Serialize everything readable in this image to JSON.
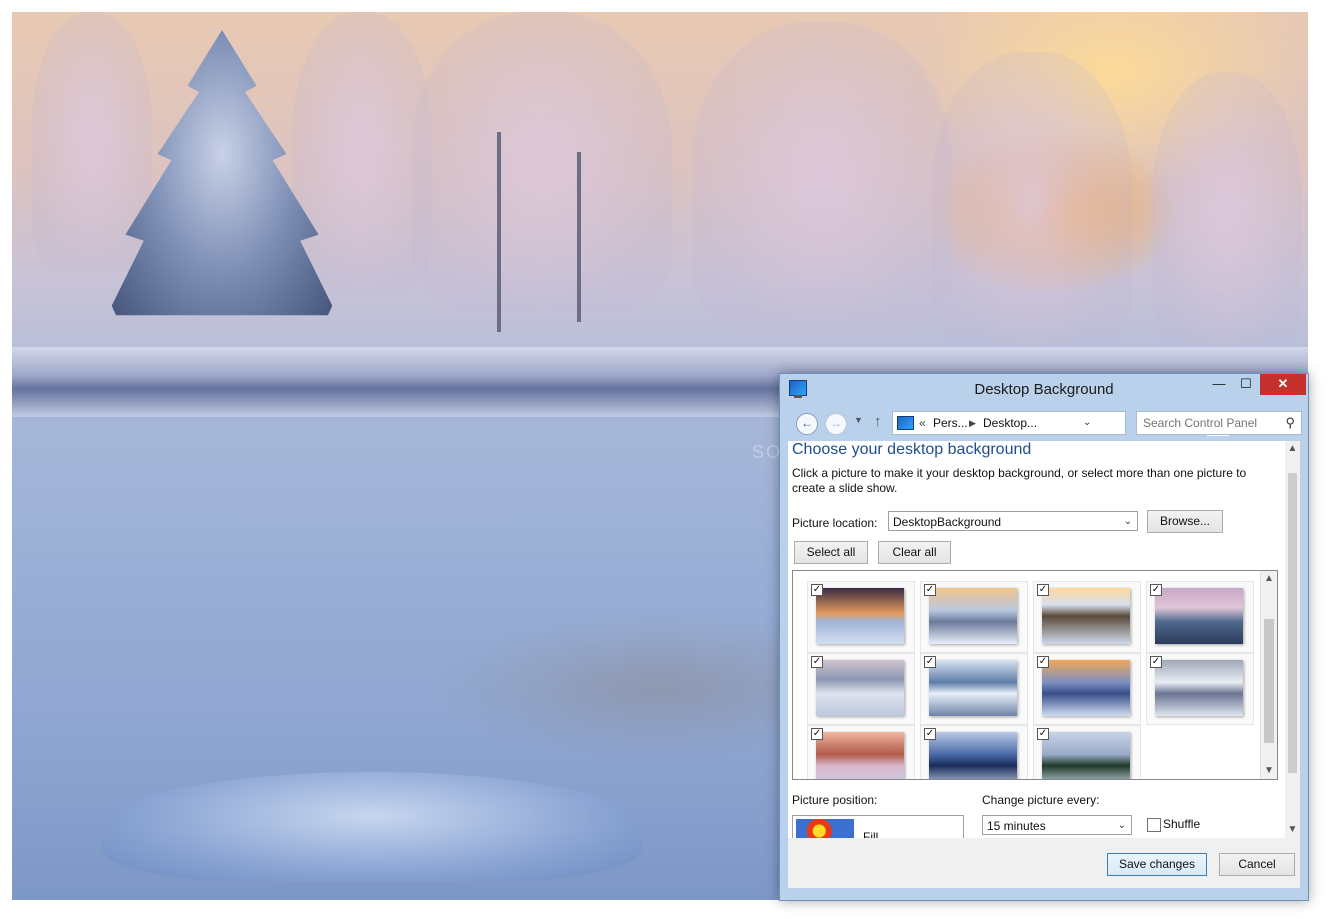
{
  "window": {
    "title": "Desktop Background"
  },
  "address": {
    "overflow": "«",
    "crumb1": "Pers...",
    "crumb2": "Desktop...",
    "search_placeholder": "Search Control Panel"
  },
  "content": {
    "heading": "Choose your desktop background",
    "description": "Click a picture to make it your desktop background, or select more than one picture to create a slide show.",
    "picture_location_label": "Picture location:",
    "picture_location_value": "DesktopBackground",
    "browse_label": "Browse...",
    "select_all_label": "Select all",
    "clear_all_label": "Clear all",
    "picture_position_label": "Picture position:",
    "picture_position_value": "Fill",
    "change_every_label": "Change picture every:",
    "change_every_value": "15 minutes",
    "shuffle_label": "Shuffle"
  },
  "thumbnails": [
    {
      "checked": true,
      "bg": "linear-gradient(#3a2a44,#e49a5a 45%,#9fb4d8 60%,#d5def0)"
    },
    {
      "checked": true,
      "bg": "linear-gradient(#f2c68a,#b9c7e0 40%,#6a7a9a 60%,#e8eef8)"
    },
    {
      "checked": true,
      "bg": "linear-gradient(#ffd79a,#d7e0ef 30%,#5a4a3a 50%,#cfd9ea)"
    },
    {
      "checked": true,
      "bg": "linear-gradient(#c9a7c9,#e0c6d6 35%,#506a8f 60%,#2a3a5a)"
    },
    {
      "checked": true,
      "bg": "linear-gradient(#cfc3cd,#8d98b3 35%,#dfe3ee 60%,#bcc7de)"
    },
    {
      "checked": true,
      "bg": "linear-gradient(#d9e4f2,#5f7ea8 40%,#e7eef8 60%,#6d84a8)"
    },
    {
      "checked": true,
      "bg": "linear-gradient(#f1a85a,#7d8fc0 40%,#3a4f8a 60%,#cfdcf0)"
    },
    {
      "checked": true,
      "bg": "linear-gradient(#9fa8b8,#e8edf4 40%,#6a7390 60%,#dfe6f0)"
    },
    {
      "checked": true,
      "bg": "linear-gradient(#f0b5a0,#b15a4a 40%,#d9b5c9 60%,#c8d2ea)"
    },
    {
      "checked": true,
      "bg": "linear-gradient(#b9c9e6,#4b6aa8 40%,#1a2d5a 60%,#c8d6ee)"
    },
    {
      "checked": true,
      "bg": "linear-gradient(#c7d2e6,#9aabc9 40%,#1e3a2a 60%,#dbe3ef)"
    }
  ],
  "footer": {
    "save_label": "Save changes",
    "cancel_label": "Cancel"
  },
  "watermark": "SOFTPEDIA"
}
